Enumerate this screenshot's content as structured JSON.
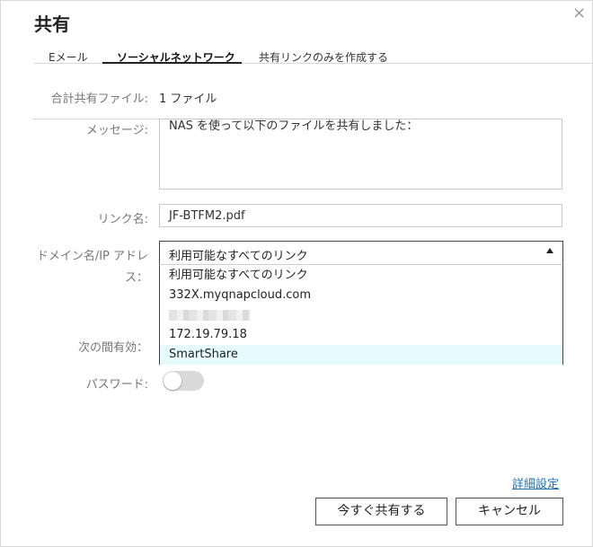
{
  "dialog": {
    "title": "共有",
    "close_glyph": "×"
  },
  "tabs": [
    {
      "label": "Eメール"
    },
    {
      "label": "ソーシャルネットワーク",
      "active": true
    },
    {
      "label": "共有リンクのみを作成する"
    }
  ],
  "form": {
    "total_files_label": "合計共有ファイル:",
    "total_files_value": "1 ファイル",
    "message_label": "メッセージ:",
    "message_value": "NAS を使って以下のファイルを共有しました：",
    "link_name_label": "リンク名:",
    "link_name_value": "JF-BTFM2.pdf",
    "domain_label_line1": "ドメイン名/IP アドレ",
    "domain_label_line2": "ス：",
    "domain_selected": "利用可能なすべてのリンク",
    "domain_options": [
      "利用可能なすべてのリンク",
      "332X.myqnapcloud.com",
      "",
      "172.19.79.18",
      "SmartShare"
    ],
    "domain_highlighted_index": 4,
    "valid_until_label": "次の間有効：",
    "password_label": "パスワード:",
    "password_enabled": false
  },
  "footer": {
    "advanced_link": "詳細設定",
    "share_now_button": "今すぐ共有する",
    "cancel_button": "キャンセル"
  },
  "colors": {
    "accent_link": "#1f73b7",
    "highlight_row": "#e6fbfb",
    "toggle_off": "#d9d9d9"
  }
}
